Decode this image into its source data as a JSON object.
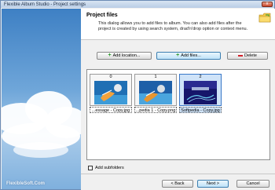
{
  "window": {
    "title": "Flexible Album Studio - Project settings",
    "close_glyph": "x"
  },
  "watermark": "FlexibleSoft.Com",
  "header": {
    "title": "Project files",
    "description": "This dialog allows you to add files to album. You can also add files after the project is created by using search system, drad'n'drop option or context menu."
  },
  "toolbar": {
    "add_location_label": "Add location...",
    "add_files_label": "Add files...",
    "delete_label": "Delete"
  },
  "files": [
    {
      "index": "0",
      "caption": "...essage - Copy.jpg",
      "selected": false
    },
    {
      "index": "1",
      "caption": "...pedia 1 - Copy.png",
      "selected": false
    },
    {
      "index": "2",
      "caption": "Softpedia - Copy.jpg",
      "selected": true
    }
  ],
  "options": {
    "add_subfolders_label": "Add subfolders",
    "add_subfolders_checked": false
  },
  "footer": {
    "back_label": "< Back",
    "next_label": "Next >",
    "cancel_label": "Cancel"
  },
  "colors": {
    "accent": "#3c7fb1",
    "sky": "#3e80c4"
  },
  "icons": [
    "folder-icon",
    "plus-icon",
    "delete-icon",
    "close-icon"
  ]
}
